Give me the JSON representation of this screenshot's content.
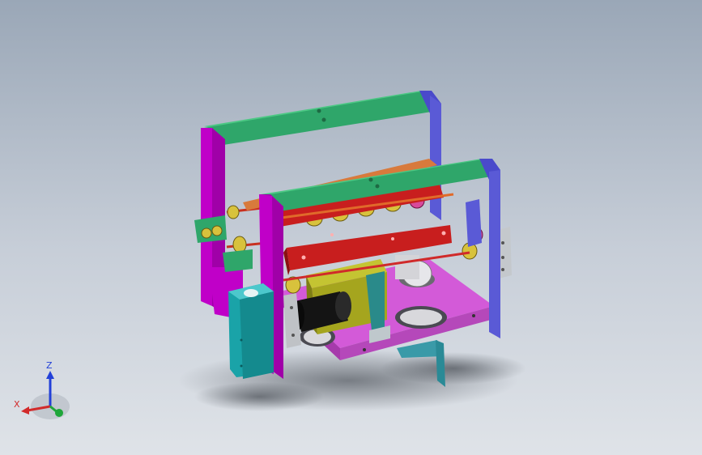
{
  "viewport": {
    "size_px": "867x562",
    "background_top": "#9aa7b7",
    "background_bottom": "#dfe3e8"
  },
  "model": {
    "part_colors": {
      "frame_top_rail": "#2fa66a",
      "side_frame_magenta": "#c000c8",
      "side_frame_blue": "#5a5ad6",
      "carriage_red": "#c81e1e",
      "base_plate": "#d35ad8",
      "cylinder_cyan": "#1aa3a8",
      "motor_black": "#141414",
      "mount_olive": "#a5a51e",
      "bracket_teal": "#2a8a8a",
      "roller_yellow": "#d8c23c"
    }
  },
  "triad": {
    "z_label": "Z",
    "x_label": "X",
    "x_color": "#d22b2b",
    "y_color": "#1fa63a",
    "z_color": "#2240d8"
  }
}
